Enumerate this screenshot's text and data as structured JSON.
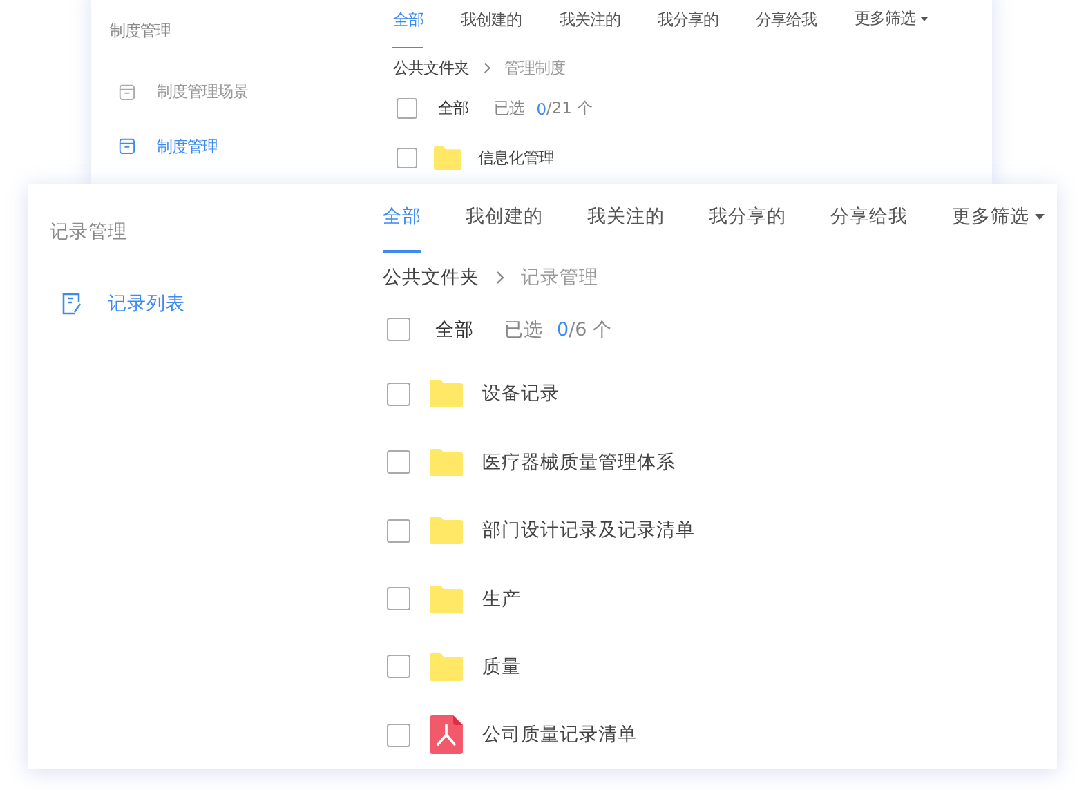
{
  "back_window": {
    "sidebar": {
      "title": "制度管理",
      "items": [
        {
          "label": "制度管理场景",
          "selected": false
        },
        {
          "label": "制度管理",
          "selected": true
        }
      ]
    },
    "tabs": [
      {
        "label": "全部",
        "selected": true
      },
      {
        "label": "我创建的",
        "selected": false
      },
      {
        "label": "我关注的",
        "selected": false
      },
      {
        "label": "我分享的",
        "selected": false
      },
      {
        "label": "分享给我",
        "selected": false
      }
    ],
    "filter_menu": {
      "label": "更多筛选"
    },
    "breadcrumb": {
      "root": "公共文件夹",
      "current": "管理制度"
    },
    "select_all": {
      "label": "全部",
      "checked": false,
      "selected_label": "已选",
      "count": "0",
      "total": "/21 个"
    },
    "files": [
      {
        "name": "信息化管理",
        "kind": "folder",
        "checked": false
      }
    ]
  },
  "front_window": {
    "sidebar": {
      "title": "记录管理",
      "items": [
        {
          "label": "记录列表",
          "selected": true
        }
      ]
    },
    "tabs": [
      {
        "label": "全部",
        "selected": true
      },
      {
        "label": "我创建的",
        "selected": false
      },
      {
        "label": "我关注的",
        "selected": false
      },
      {
        "label": "我分享的",
        "selected": false
      },
      {
        "label": "分享给我",
        "selected": false
      }
    ],
    "filter_menu": {
      "label": "更多筛选"
    },
    "breadcrumb": {
      "root": "公共文件夹",
      "current": "记录管理"
    },
    "select_all": {
      "label": "全部",
      "checked": false,
      "selected_label": "已选",
      "count": "0",
      "total": "/6 个"
    },
    "files": [
      {
        "name": "设备记录",
        "kind": "folder",
        "checked": false
      },
      {
        "name": "医疗器械质量管理体系",
        "kind": "folder",
        "checked": false
      },
      {
        "name": "部门设计记录及记录清单",
        "kind": "folder",
        "checked": false
      },
      {
        "name": "生产",
        "kind": "folder",
        "checked": false
      },
      {
        "name": "质量",
        "kind": "folder",
        "checked": false
      },
      {
        "name": "公司质量记录清单",
        "kind": "pdf",
        "checked": false
      }
    ]
  }
}
